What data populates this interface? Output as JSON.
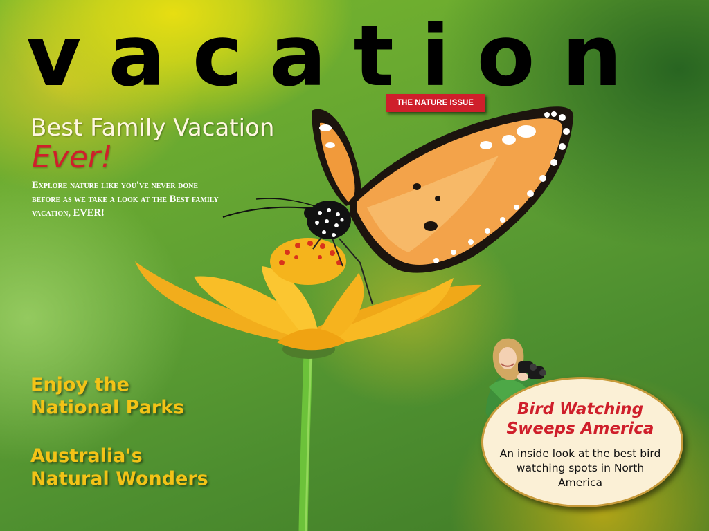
{
  "cover": {
    "masthead": "vacation",
    "issue_badge": "THE NATURE ISSUE",
    "feature": {
      "headline": "Best Family Vacation",
      "headline_emphasis": "Ever!",
      "blurb": "Explore nature like you've never done before as we take a look at the Best family vacation, EVER!"
    },
    "cover_lines": [
      "Enjoy the National Parks",
      "Australia's Natural Wonders"
    ],
    "sidebar_story": {
      "title": "Bird Watching Sweeps America",
      "body": "An inside look at the best bird watching spots in North America"
    }
  },
  "colors": {
    "accent_red": "#cf1f2b",
    "cover_line_yellow": "#f3c317",
    "masthead_black": "#000000",
    "oval_background": "#fbf0d6"
  },
  "icons": [
    "butterfly-illustration",
    "flower-illustration",
    "girl-with-binoculars-illustration"
  ]
}
